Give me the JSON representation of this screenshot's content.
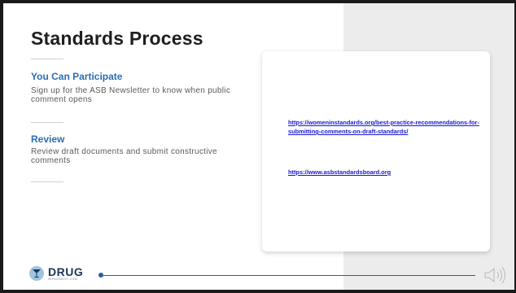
{
  "slide": {
    "title": "Standards Process",
    "sections": [
      {
        "heading": "You Can Participate",
        "body": "Sign up for the ASB Newsletter to know when public comment opens"
      },
      {
        "heading": "Review",
        "body": "Review draft documents and submit constructive comments"
      }
    ],
    "links": [
      "https://womeninstandards.org/best-practice-recommendations-for-submitting-comments-on-draft-standards/",
      "https://www.asbstandardsboard.org"
    ]
  },
  "footer": {
    "logo_name": "DRUG",
    "logo_sub": "IMPAIRMENT.COM",
    "audio_icon": "speaker-icon"
  },
  "colors": {
    "heading_blue": "#2a6db3",
    "link_blue": "#1a1ad6",
    "footer_line": "#2a5d9f",
    "panel_gray": "#ececec"
  }
}
